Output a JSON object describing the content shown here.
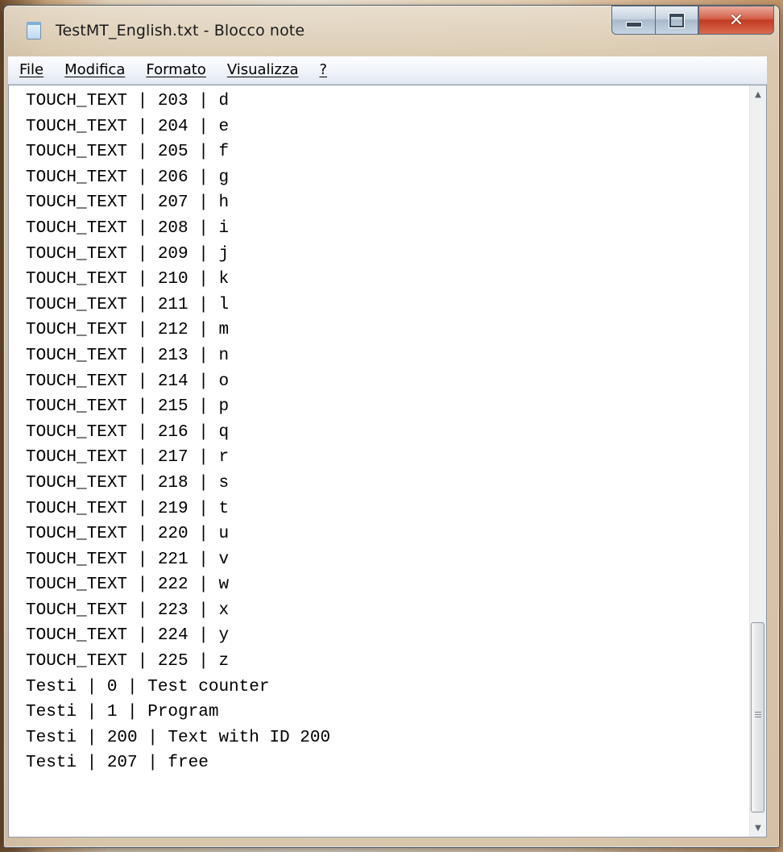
{
  "window": {
    "title": "TestMT_English.txt - Blocco note"
  },
  "menu": {
    "items": [
      "File",
      "Modifica",
      "Formato",
      "Visualizza",
      "?"
    ]
  },
  "editor": {
    "lines": [
      "TOUCH_TEXT | 203 | d",
      "TOUCH_TEXT | 204 | e",
      "TOUCH_TEXT | 205 | f",
      "TOUCH_TEXT | 206 | g",
      "TOUCH_TEXT | 207 | h",
      "TOUCH_TEXT | 208 | i",
      "TOUCH_TEXT | 209 | j",
      "TOUCH_TEXT | 210 | k",
      "TOUCH_TEXT | 211 | l",
      "TOUCH_TEXT | 212 | m",
      "TOUCH_TEXT | 213 | n",
      "TOUCH_TEXT | 214 | o",
      "TOUCH_TEXT | 215 | p",
      "TOUCH_TEXT | 216 | q",
      "TOUCH_TEXT | 217 | r",
      "TOUCH_TEXT | 218 | s",
      "TOUCH_TEXT | 219 | t",
      "TOUCH_TEXT | 220 | u",
      "TOUCH_TEXT | 221 | v",
      "TOUCH_TEXT | 222 | w",
      "TOUCH_TEXT | 223 | x",
      "TOUCH_TEXT | 224 | y",
      "TOUCH_TEXT | 225 | z",
      "Testi | 0 | Test counter",
      "Testi | 1 | Program",
      "Testi | 200 | Text with ID 200",
      "Testi | 207 | free"
    ]
  },
  "icons": {
    "app": "notepad-icon",
    "minimize": "minimize-icon",
    "maximize": "maximize-icon",
    "close": "close-icon",
    "scroll_up": "arrow-up-icon",
    "scroll_down": "arrow-down-icon"
  },
  "colors": {
    "close_button": "#c23a22",
    "menubar": "#eef2f9",
    "editor_background": "#ffffff"
  }
}
